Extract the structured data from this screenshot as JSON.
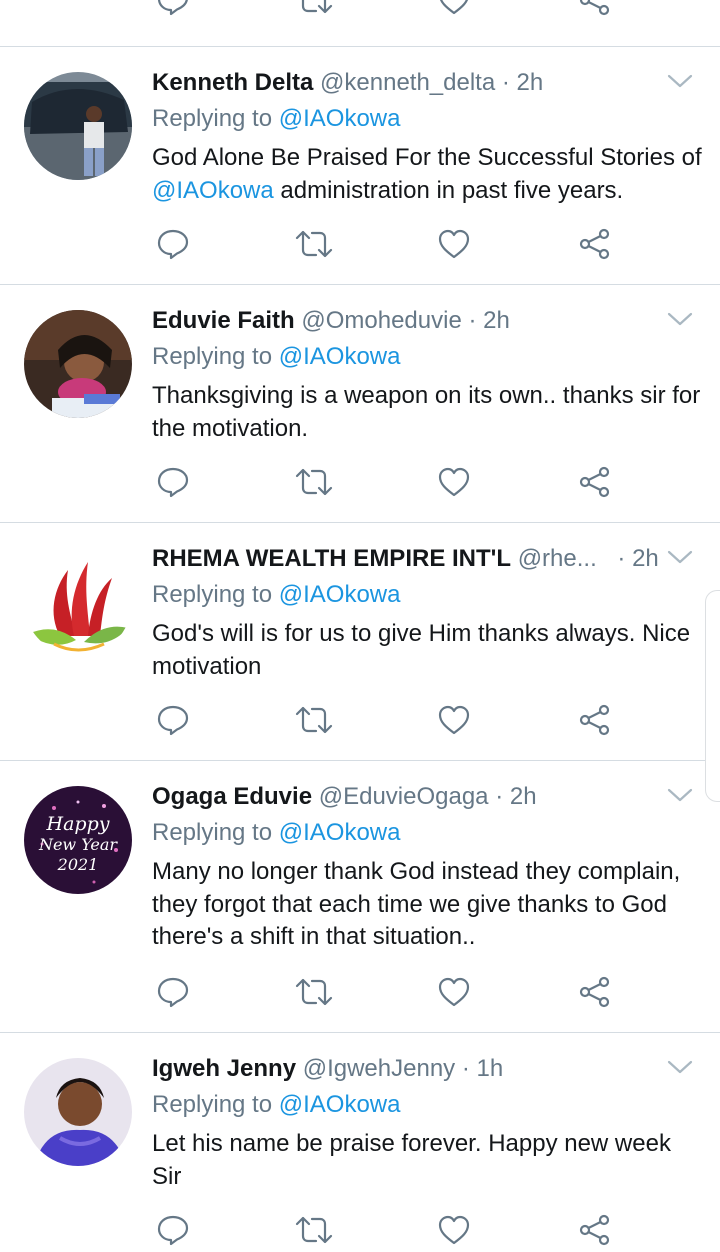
{
  "reply_prefix": "Replying to",
  "tweets": [
    {
      "name": "Kenneth Delta",
      "handle": "@kenneth_delta",
      "time": "· 2h",
      "reply_to": "@IAOkowa",
      "text_a": "God Alone Be Praised For the Successful Stories of ",
      "text_mention": "@IAOkowa",
      "text_b": " administration in past five years."
    },
    {
      "name": "Eduvie Faith",
      "handle": "@Omoheduvie",
      "time": "· 2h",
      "reply_to": "@IAOkowa",
      "text": "Thanksgiving is a weapon on its own.. thanks sir for the motivation."
    },
    {
      "name": "RHEMA WEALTH EMPIRE INT'L",
      "handle": "@rhe...",
      "time": "· 2h",
      "reply_to": "@IAOkowa",
      "text": "God's will is for us to give Him thanks always. Nice motivation"
    },
    {
      "name": "Ogaga Eduvie",
      "handle": "@EduvieOgaga",
      "time": "· 2h",
      "reply_to": "@IAOkowa",
      "text": "Many no longer thank God instead they complain, they forgot that each time we give thanks to God there's a shift in that situation..",
      "avatar_text": [
        "Happy",
        "New Year",
        "2021"
      ]
    },
    {
      "name": "Igweh Jenny",
      "handle": "@IgwehJenny",
      "time": "· 1h",
      "reply_to": "@IAOkowa",
      "text": "Let his name be praise forever. Happy new week Sir"
    }
  ],
  "icons": {
    "reply": "reply-icon",
    "retweet": "retweet-icon",
    "like": "heart-icon",
    "share": "share-icon",
    "menu": "chevron-down-icon"
  },
  "colors": {
    "mention": "#1b95e0",
    "secondary": "#657786",
    "primary": "#14171a",
    "divider": "#d5dce2"
  }
}
